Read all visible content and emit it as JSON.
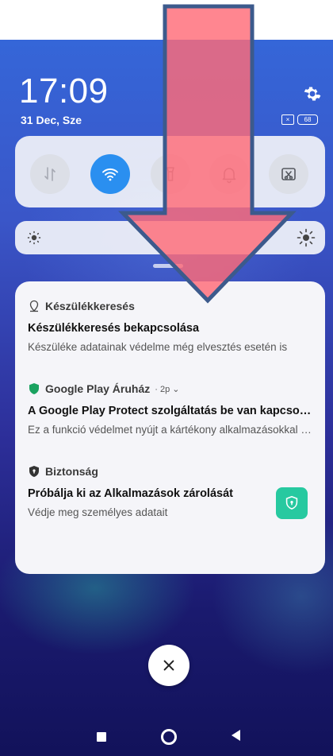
{
  "status": {
    "time": "17:09",
    "date": "31 Dec, Sze",
    "sim_label": "×",
    "battery_level": "68"
  },
  "icons": {
    "settings": "gear-icon",
    "data": "mobile-data-icon",
    "wifi": "wifi-icon",
    "flashlight": "flashlight-icon",
    "sound": "bell-icon",
    "screenshot": "screenshot-icon",
    "brightness_low": "brightness-low-icon",
    "brightness_high": "brightness-high-icon",
    "close": "close-icon"
  },
  "quick_settings": {
    "tiles": [
      {
        "name": "mobile-data",
        "active": false
      },
      {
        "name": "wifi",
        "active": true
      },
      {
        "name": "flashlight",
        "active": false
      },
      {
        "name": "sound",
        "active": false
      },
      {
        "name": "screenshot",
        "active": false
      }
    ]
  },
  "notifications": [
    {
      "app": "Készülékkeresés",
      "title": "Készülékkeresés bekapcsolása",
      "body": "Készüléke adatainak védelme még elvesztés esetén is"
    },
    {
      "app": "Google Play Áruház",
      "meta": "· 2p ⌄",
      "title": "A Google Play Protect szolgáltatás be van kapcsolva",
      "body": "Ez a funkció védelmet nyújt a kártékony alkalmazásokkal szemben"
    },
    {
      "app": "Biztonság",
      "title": "Próbálja ki az Alkalmazások zárolását",
      "body": "Védje meg személyes adatait"
    }
  ],
  "colors": {
    "wifi_active": "#2a8ff0",
    "play_protect_green": "#1aa260",
    "lock_tile": "#27c9a0",
    "overlay_arrow_fill": "#ff6b78",
    "overlay_arrow_stroke": "#3c5a8c"
  }
}
